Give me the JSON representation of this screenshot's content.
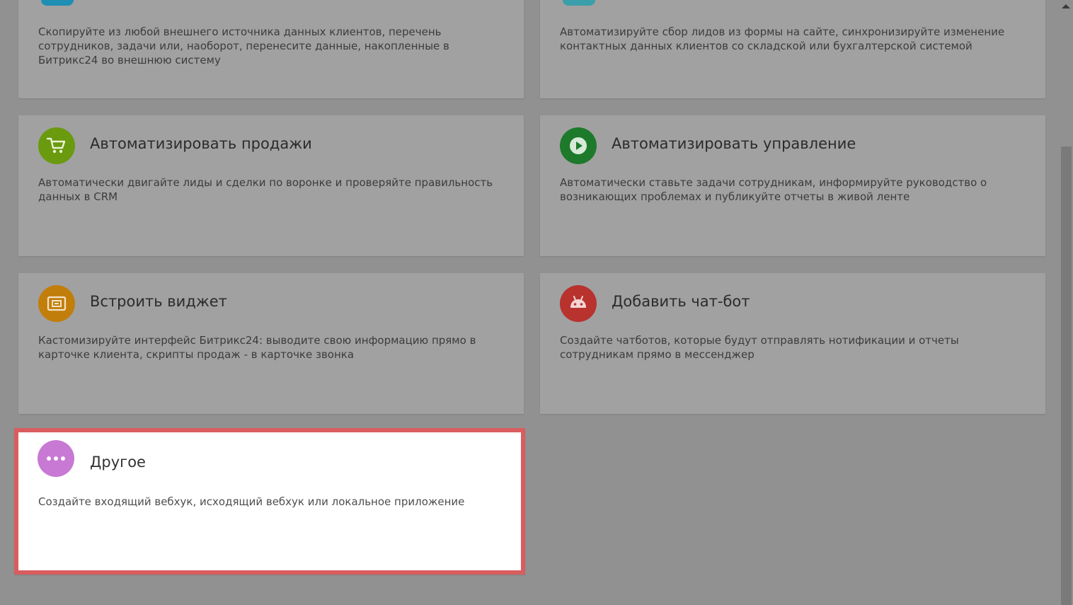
{
  "cards": [
    {
      "desc": "Скопируйте из любой внешнего источника данных клиентов, перечень сотрудников, задачи или, наоборот, перенесите данные, накопленные в Битрикс24 во внешнюю систему",
      "icon": "partial-icon",
      "icon_color": "#1e8fb3"
    },
    {
      "desc": "Автоматизируйте сбор лидов из формы на сайте, синхронизируйте изменение контактных данных клиентов со складской или бухгалтерской системой",
      "icon": "partial-icon",
      "icon_color": "#3a9faa"
    },
    {
      "title": "Автоматизировать продажи",
      "desc": "Автоматически двигайте лиды и сделки по воронке и проверяйте правильность данных в CRM",
      "icon": "cart-icon",
      "icon_color": "#6a9a0e"
    },
    {
      "title": "Автоматизировать управление",
      "desc": "Автоматически ставьте задачи сотрудникам, информируйте руководство о возникающих проблемах и публикуйте отчеты в живой ленте",
      "icon": "play-icon",
      "icon_color": "#1d7a2b"
    },
    {
      "title": "Встроить виджет",
      "desc": "Кастомизируйте интерфейс Битрикс24: выводите свою информацию прямо в карточке клиента, скрипты продаж - в карточке звонка",
      "icon": "widget-icon",
      "icon_color": "#c27e0a"
    },
    {
      "title": "Добавить чат-бот",
      "desc": "Создайте чатботов, которые будут отправлять нотификации и отчеты сотрудникам прямо в мессенджер",
      "icon": "robot-icon",
      "icon_color": "#b8322e"
    },
    {
      "title": "Другое",
      "desc": "Создайте входящий вебхук, исходящий вебхук или локальное приложение",
      "icon": "more-dots-icon",
      "icon_color": "#c879d4"
    }
  ],
  "highlight_color": "#d95d5f"
}
